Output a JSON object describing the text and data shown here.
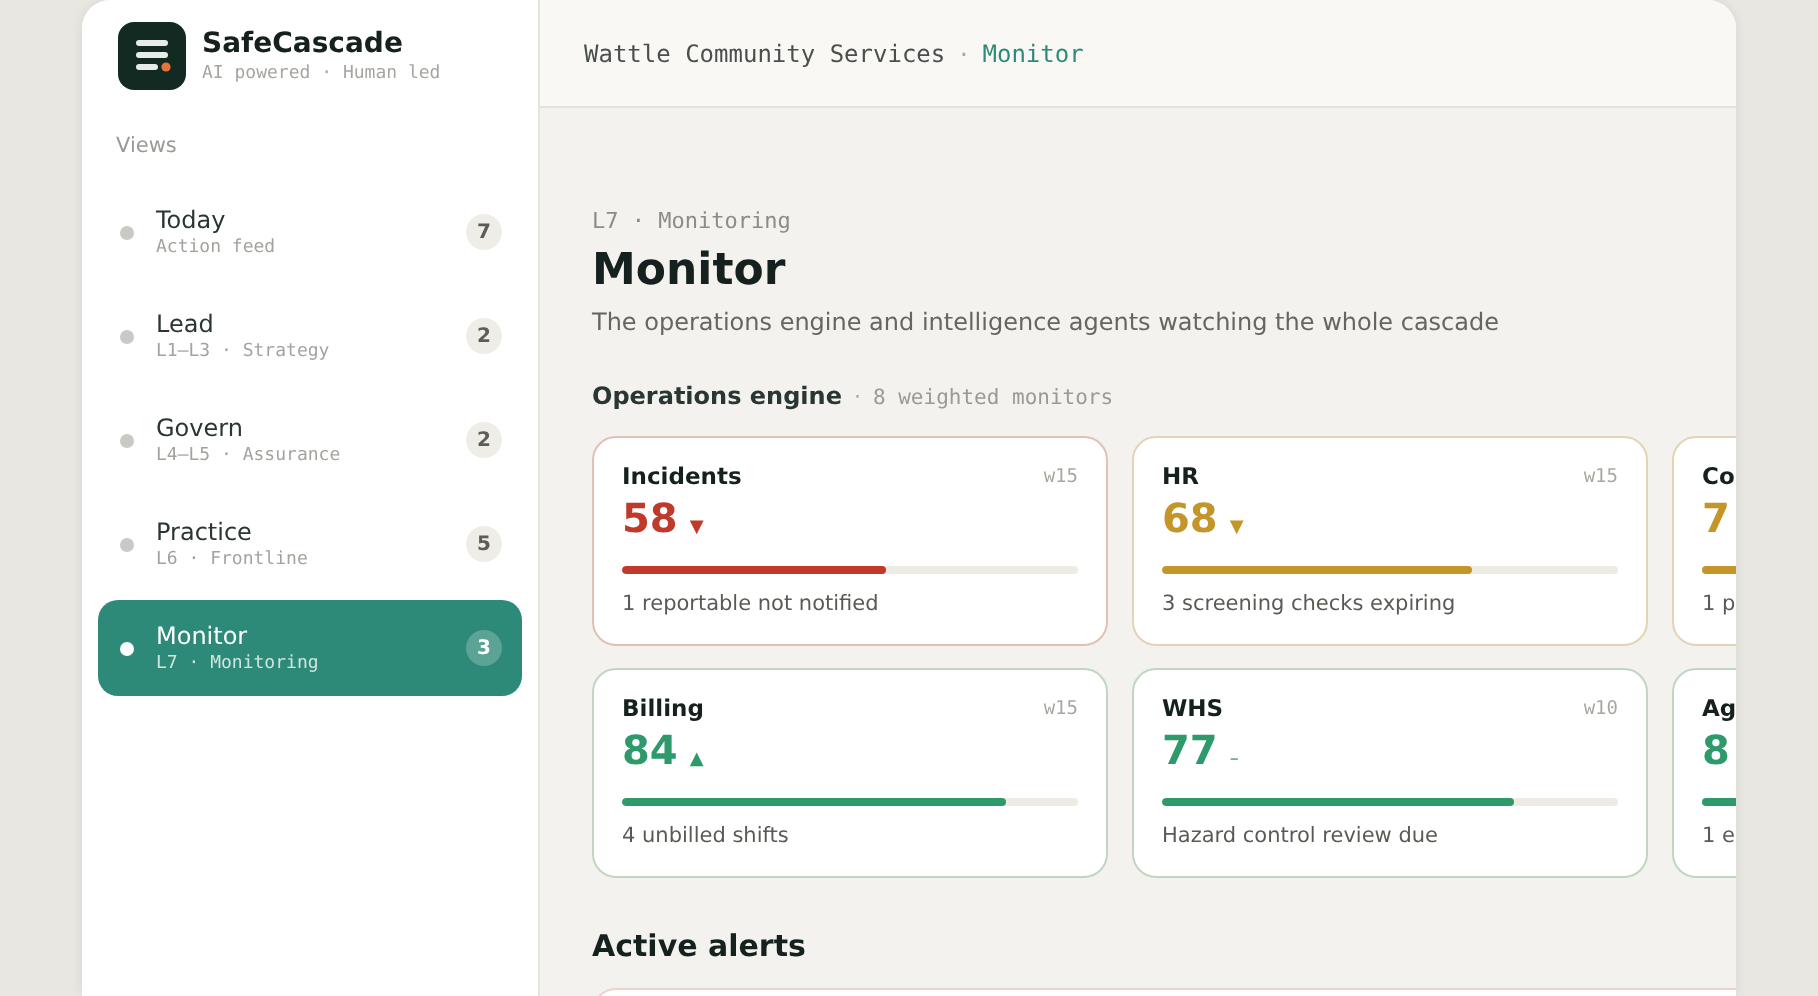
{
  "brand": {
    "name": "SafeCascade",
    "tagline": "AI powered · Human led"
  },
  "sidebar": {
    "heading": "Views",
    "items": [
      {
        "label": "Today",
        "sub": "Action feed",
        "count": "7",
        "selected": false
      },
      {
        "label": "Lead",
        "sub": "L1–L3 · Strategy",
        "count": "2",
        "selected": false
      },
      {
        "label": "Govern",
        "sub": "L4–L5 · Assurance",
        "count": "2",
        "selected": false
      },
      {
        "label": "Practice",
        "sub": "L6 · Frontline",
        "count": "5",
        "selected": false
      },
      {
        "label": "Monitor",
        "sub": "L7 · Monitoring",
        "count": "3",
        "selected": true
      }
    ]
  },
  "breadcrumb": {
    "org": "Wattle Community Services",
    "separator": "·",
    "current": "Monitor"
  },
  "page": {
    "eyebrow": "L7 · Monitoring",
    "title": "Monitor",
    "description": "The operations engine and intelligence agents watching the whole cascade"
  },
  "section": {
    "title": "Operations engine",
    "separator": "·",
    "note": "8 weighted monitors"
  },
  "monitors": [
    {
      "name": "Incidents",
      "weight": "w15",
      "score": "58",
      "trend": "▼",
      "color": "#c0392b",
      "level": 0.58,
      "note": "1 reportable not notified"
    },
    {
      "name": "HR",
      "weight": "w15",
      "score": "68",
      "trend": "▼",
      "color": "#c4962a",
      "level": 0.68,
      "note": "3 screening checks expiring"
    },
    {
      "name": "Co",
      "score": "7",
      "color": "#c4962a",
      "note": "1 p"
    },
    {
      "name": "Billing",
      "weight": "w15",
      "score": "84",
      "trend": "▲",
      "color": "#2e9a6c",
      "level": 0.84,
      "note": "4 unbilled shifts"
    },
    {
      "name": "WHS",
      "weight": "w10",
      "score": "77",
      "trend": "–",
      "color": "#2e9a6c",
      "level": 0.77,
      "note": "Hazard control review due"
    },
    {
      "name": "Ag",
      "score": "8",
      "color": "#2e9a6c",
      "note": "1 e"
    }
  ],
  "alerts": {
    "title": "Active alerts"
  }
}
